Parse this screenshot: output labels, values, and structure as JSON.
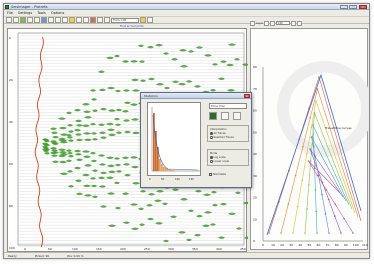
{
  "window": {
    "title": "SeisImager - Plotrefa",
    "minimize": "_",
    "maximize": "□",
    "close": "×"
  },
  "menu": [
    "File",
    "Settings",
    "Tools",
    "Options"
  ],
  "toolbar": {
    "link": "First arrival picks",
    "selector": "Trace 1-96"
  },
  "right_toolbar": {
    "zoom": "100",
    "label": "Layer"
  },
  "dialog": {
    "title": "Statistics",
    "select": "Time (ms)",
    "group1": {
      "label": "Interpolation",
      "options": [
        "All Traces",
        "Selected Traces"
      ],
      "selected": 0
    },
    "group2": {
      "label": "Mode",
      "options": [
        "Log scale",
        "Linear scale"
      ],
      "selected": 0
    },
    "checkbox": "Normalize",
    "histogram": {
      "x_ticks": [
        "0",
        "50",
        "100",
        "150"
      ]
    }
  },
  "left_plot": {
    "x_ticks": [
      "0",
      "50",
      "100",
      "150",
      "200",
      "250",
      "300",
      "350",
      "400",
      "450"
    ],
    "y_ticks": [
      "0",
      "20",
      "40",
      "60",
      "80",
      "100"
    ]
  },
  "right_plot": {
    "y_ticks": [
      "0",
      "10",
      "20",
      "30",
      "40",
      "50",
      "60",
      "70",
      "80"
    ],
    "x_ticks": [
      "0",
      "10",
      "20",
      "30",
      "40",
      "50",
      "60",
      "70",
      "80",
      "90",
      "100",
      "110"
    ],
    "annotation": "Traveltime curves"
  },
  "status": [
    "Ready",
    "Picked: 96",
    "Pos: 0.00 m"
  ],
  "colors": {
    "wave": "#3f9a2c",
    "pick": "#cc3300",
    "accent": "#2a4fd0"
  }
}
